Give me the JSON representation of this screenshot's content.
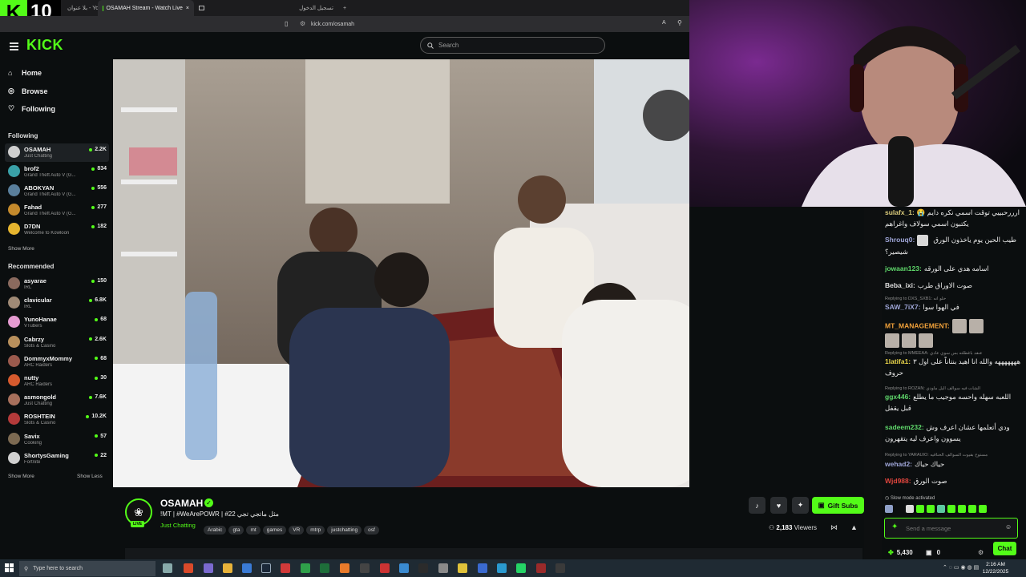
{
  "browser": {
    "tabs": [
      {
        "label": "بلا عنوان - YouTube"
      },
      {
        "label": "OSAMAH Stream - Watch Live"
      },
      {
        "label": ""
      },
      {
        "label": "تسجيل الدخول"
      }
    ],
    "url": "kick.com/osamah"
  },
  "overlay_logo": {
    "letter": "K",
    "number": "10"
  },
  "header": {
    "brand": "KICK",
    "search_placeholder": "Search"
  },
  "sidebar": {
    "nav": [
      {
        "label": "Home",
        "icon": "home-icon"
      },
      {
        "label": "Browse",
        "icon": "compass-icon"
      },
      {
        "label": "Following",
        "icon": "heart-icon"
      }
    ],
    "following_title": "Following",
    "following": [
      {
        "name": "OSAMAH",
        "category": "Just Chatting",
        "viewers": "2.2K",
        "color": "#cfcfcf"
      },
      {
        "name": "brof2",
        "category": "Grand Theft Auto V (G...",
        "viewers": "834",
        "color": "#3aa1a8"
      },
      {
        "name": "ABOKYAN",
        "category": "Grand Theft Auto V (G...",
        "viewers": "556",
        "color": "#5a7f9c"
      },
      {
        "name": "Fahad",
        "category": "Grand Theft Auto V (G...",
        "viewers": "277",
        "color": "#c48a2c"
      },
      {
        "name": "D7DN",
        "category": "Welcome to Kowloon",
        "viewers": "182",
        "color": "#e6b52f"
      }
    ],
    "show_more_1": "Show More",
    "recommended_title": "Recommended",
    "recommended": [
      {
        "name": "asyarae",
        "category": "IRL",
        "viewers": "150",
        "color": "#8a6a5e"
      },
      {
        "name": "clavicular",
        "category": "IRL",
        "viewers": "6.8K",
        "color": "#a08a76"
      },
      {
        "name": "YunoHanae",
        "category": "VTubers",
        "viewers": "68",
        "color": "#e59bd1"
      },
      {
        "name": "Cabrzy",
        "category": "Slots & Casino",
        "viewers": "2.6K",
        "color": "#b9905c"
      },
      {
        "name": "DommyxMommy",
        "category": "ARC Raiders",
        "viewers": "68",
        "color": "#9b5a4d"
      },
      {
        "name": "nutty",
        "category": "ARC Raiders",
        "viewers": "30",
        "color": "#d65a2e"
      },
      {
        "name": "asmongold",
        "category": "Just Chatting",
        "viewers": "7.6K",
        "color": "#a8705c"
      },
      {
        "name": "ROSHTEIN",
        "category": "Slots & Casino",
        "viewers": "10.2K",
        "color": "#b43a3a"
      },
      {
        "name": "Savix",
        "category": "Cooking",
        "viewers": "57",
        "color": "#7c6a52"
      },
      {
        "name": "ShortysGaming",
        "category": "Fortnite",
        "viewers": "22",
        "color": "#d0d0d0"
      }
    ],
    "show_more_2": "Show More",
    "show_less": "Show Less"
  },
  "stream": {
    "streamer": "OSAMAH",
    "live_badge": "LIVE",
    "title": "!MT | #WeArePOWR | #22 مثل ماتجي تجي",
    "category": "Just Chatting",
    "tags": [
      "Arabic",
      "gta",
      "mt",
      "games",
      "VR",
      "mtrp",
      "justchatting",
      "osf"
    ],
    "viewers": "2,183",
    "viewers_label": "Viewers",
    "gift_button": "Gift Subs"
  },
  "chat": {
    "messages": [
      {
        "user": "sulafx_1:",
        "color": "#d8c97a",
        "text": "ارررحبييي توقت اسمي نكره دايم 😭 يكتبون اسمي سولاف واغراهم",
        "reply": ""
      },
      {
        "user": "Shrouq0:",
        "color": "#9fa6d8",
        "text": "طيب الحين يوم ياخذون الورق شيصير؟",
        "reply": ""
      },
      {
        "user": "jowaan123:",
        "color": "#5fd86b",
        "text": "اسامه هدي على الورقه",
        "reply": ""
      },
      {
        "user": "Beba_ixi:",
        "color": "#e0e0e0",
        "text": "صوت الاوراق طرب",
        "reply": ""
      },
      {
        "user": "SAW_7iX7:",
        "color": "#9fa6d8",
        "text": "في الهوا سوا",
        "reply": "Replying to DXS_SXB1: حلو انه"
      },
      {
        "user": "MT_MANAGEMENT:",
        "color": "#f2a23a",
        "text": "",
        "reply": ""
      },
      {
        "user": "1latifa1:",
        "color": "#e6d24a",
        "text": "هههههههه والله انا اهيد بنتاناً على اول ٣ حروف",
        "reply": "Replying to MMEEAA: عنقد باغطلته بس سوي عادي"
      },
      {
        "user": "ggx446:",
        "color": "#5fd86b",
        "text": "اللعبه سهله واحسه موجيب ما يطلع قبل يقفل",
        "reply": "Replying to ROZAN: الشات فيه سوالف اليل ماودي"
      },
      {
        "user": "sadeem232:",
        "color": "#5fd86b",
        "text": "ودي أتعلمها عشان اعرف وش يسوون واعرف ليه يتقهرون",
        "reply": ""
      },
      {
        "user": "wehad2:",
        "color": "#9fa6d8",
        "text": "حياك حياك",
        "reply": "Replying to YARAUIO: مستوح بقيوت السوالف الحناقيه"
      },
      {
        "user": "Wjd988:",
        "color": "#e2463e",
        "text": "صوت الورق",
        "reply": ""
      }
    ],
    "slow_mode": "Slow mode activated",
    "input_placeholder": "Send a message",
    "points": "5,430",
    "gifts": "0",
    "chat_button": "Chat"
  },
  "taskbar": {
    "search_placeholder": "Type here to search",
    "time": "2:16 AM",
    "date": "12/22/2025"
  }
}
